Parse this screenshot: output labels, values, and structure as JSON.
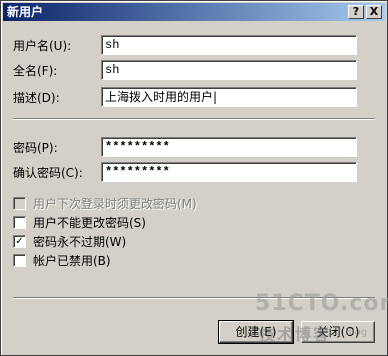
{
  "window": {
    "title": "新用户",
    "help_glyph": "?",
    "close_glyph": "X"
  },
  "form": {
    "username_label": "用户名(U):",
    "username_value": "sh",
    "fullname_label": "全名(F):",
    "fullname_value": "sh",
    "description_label": "描述(D):",
    "description_value": "上海拨入时用的用户|",
    "password_label": "密码(P):",
    "password_value": "*********",
    "confirm_label": "确认密码(C):",
    "confirm_value": "*********"
  },
  "options": [
    {
      "label": "用户下次登录时须更改密码(M)",
      "checked": false,
      "disabled": true
    },
    {
      "label": "用户不能更改密码(S)",
      "checked": false,
      "disabled": false
    },
    {
      "label": "密码永不过期(W)",
      "checked": true,
      "disabled": false
    },
    {
      "label": "帐户已禁用(B)",
      "checked": false,
      "disabled": false
    }
  ],
  "buttons": {
    "create_label": "创建(E)",
    "close_label": "关闭(O)"
  },
  "watermark": {
    "site": "51CTO.com",
    "sub": "技术博客",
    "blog": "Blog"
  }
}
